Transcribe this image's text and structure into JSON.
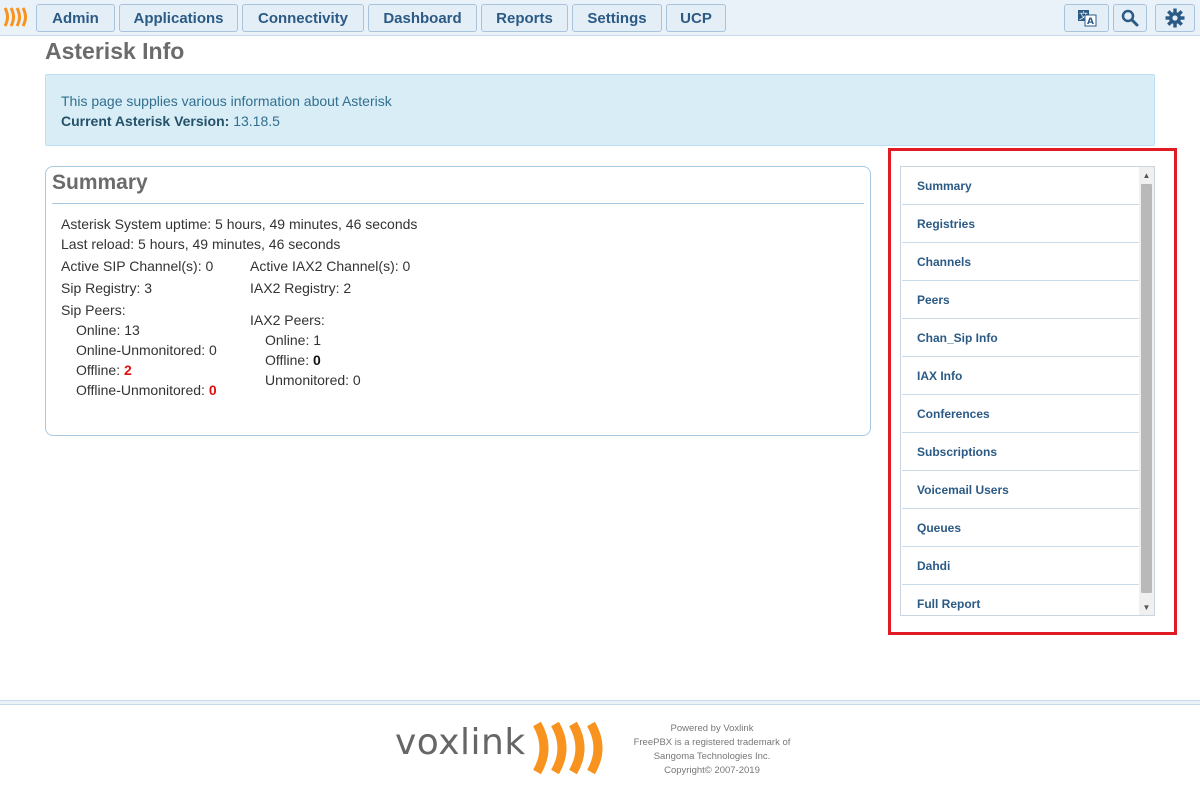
{
  "nav": {
    "items": [
      {
        "label": "Admin"
      },
      {
        "label": "Applications"
      },
      {
        "label": "Connectivity"
      },
      {
        "label": "Dashboard"
      },
      {
        "label": "Reports"
      },
      {
        "label": "Settings"
      },
      {
        "label": "UCP"
      }
    ],
    "icons": [
      "translate-icon",
      "search-icon",
      "gear-icon"
    ]
  },
  "page": {
    "title": "Asterisk Info"
  },
  "info": {
    "description": "This page supplies various information about Asterisk",
    "version_label": "Current Asterisk Version:",
    "version_value": "13.18.5"
  },
  "summary": {
    "title": "Summary",
    "uptime": "Asterisk System uptime: 5 hours, 49 minutes, 46 seconds",
    "last_reload": "Last reload: 5 hours, 49 minutes, 46 seconds",
    "sip": {
      "active_channels": "Active SIP Channel(s): 0",
      "registry": "Sip Registry: 3",
      "peers_label": "Sip Peers:",
      "online": "Online: 13",
      "online_unmonitored": "Online-Unmonitored: 0",
      "offline_label": "Offline:",
      "offline_value": "2",
      "offline_unmonitored_label": "Offline-Unmonitored:",
      "offline_unmonitored_value": "0"
    },
    "iax2": {
      "active_channels": "Active IAX2 Channel(s): 0",
      "registry": "IAX2 Registry: 2",
      "peers_label": "IAX2 Peers:",
      "online": "Online: 1",
      "offline_label": "Offline:",
      "offline_value": "0",
      "unmonitored": "Unmonitored: 0"
    }
  },
  "menu": {
    "items": [
      {
        "label": "Summary"
      },
      {
        "label": "Registries"
      },
      {
        "label": "Channels"
      },
      {
        "label": "Peers"
      },
      {
        "label": "Chan_Sip Info"
      },
      {
        "label": "IAX Info"
      },
      {
        "label": "Conferences"
      },
      {
        "label": "Subscriptions"
      },
      {
        "label": "Voicemail Users"
      },
      {
        "label": "Queues"
      },
      {
        "label": "Dahdi"
      },
      {
        "label": "Full Report"
      }
    ]
  },
  "footer": {
    "brand": "voxlink",
    "lines": [
      "Powered by Voxlink",
      "FreePBX is a registered trademark of",
      "Sangoma Technologies Inc.",
      "Copyright© 2007-2019"
    ]
  },
  "colors": {
    "accent": "#2b5a85",
    "brand_orange": "#f7931e",
    "alert_red": "#e01010",
    "highlight_frame": "#e01b24"
  }
}
